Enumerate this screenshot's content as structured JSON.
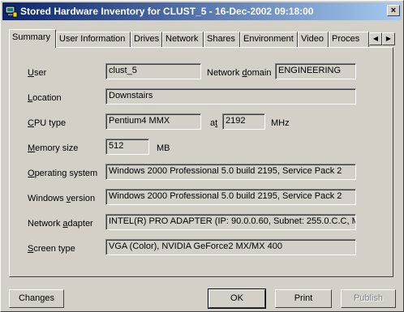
{
  "window": {
    "title": "Stored Hardware Inventory for CLUST_5 - 16-Dec-2002 09:18:00",
    "close_label": "×"
  },
  "tabs": [
    {
      "label": "Summary",
      "active": true
    },
    {
      "label": "User Information"
    },
    {
      "label": "Drives"
    },
    {
      "label": "Network"
    },
    {
      "label": "Shares"
    },
    {
      "label": "Environment"
    },
    {
      "label": "Video"
    },
    {
      "label": "Proces"
    }
  ],
  "tab_scroll": {
    "left": "◀",
    "right": "▶"
  },
  "summary": {
    "user": {
      "label_ul": "U",
      "label_rest": "ser",
      "value": "clust_5"
    },
    "network_domain": {
      "label_pre": "Network ",
      "label_ul": "d",
      "label_rest": "omain",
      "value": "ENGINEERING"
    },
    "location": {
      "label_ul": "L",
      "label_rest": "ocation",
      "value": "Downstairs"
    },
    "cpu_type": {
      "label_ul": "C",
      "label_rest": "PU type",
      "value": "Pentium4 MMX"
    },
    "cpu_at": {
      "label_pre": "a",
      "label_ul": "t",
      "value": "2192"
    },
    "cpu_unit": "MHz",
    "memory": {
      "label_ul": "M",
      "label_rest": "emory size",
      "value": "512",
      "unit": "MB"
    },
    "os": {
      "label_ul": "O",
      "label_rest": "perating system",
      "value": "Windows 2000 Professional 5.0 build 2195, Service Pack 2"
    },
    "win_version": {
      "label_pre": "Windows ",
      "label_ul": "v",
      "label_rest": "ersion",
      "value": "Windows 2000 Professional 5.0 build 2195, Service Pack 2"
    },
    "net_adapter": {
      "label_pre": "Network ",
      "label_ul": "a",
      "label_rest": "dapter",
      "value": "INTEL(R) PRO ADAPTER (IP: 90.0.0.60, Subnet: 255.0.C.C, M"
    },
    "screen": {
      "label_ul": "S",
      "label_rest": "creen type",
      "value": "VGA (Color), NVIDIA GeForce2 MX/MX 400"
    }
  },
  "buttons": {
    "changes": "Changes",
    "ok": "OK",
    "print": "Print",
    "publish": "Publish"
  }
}
